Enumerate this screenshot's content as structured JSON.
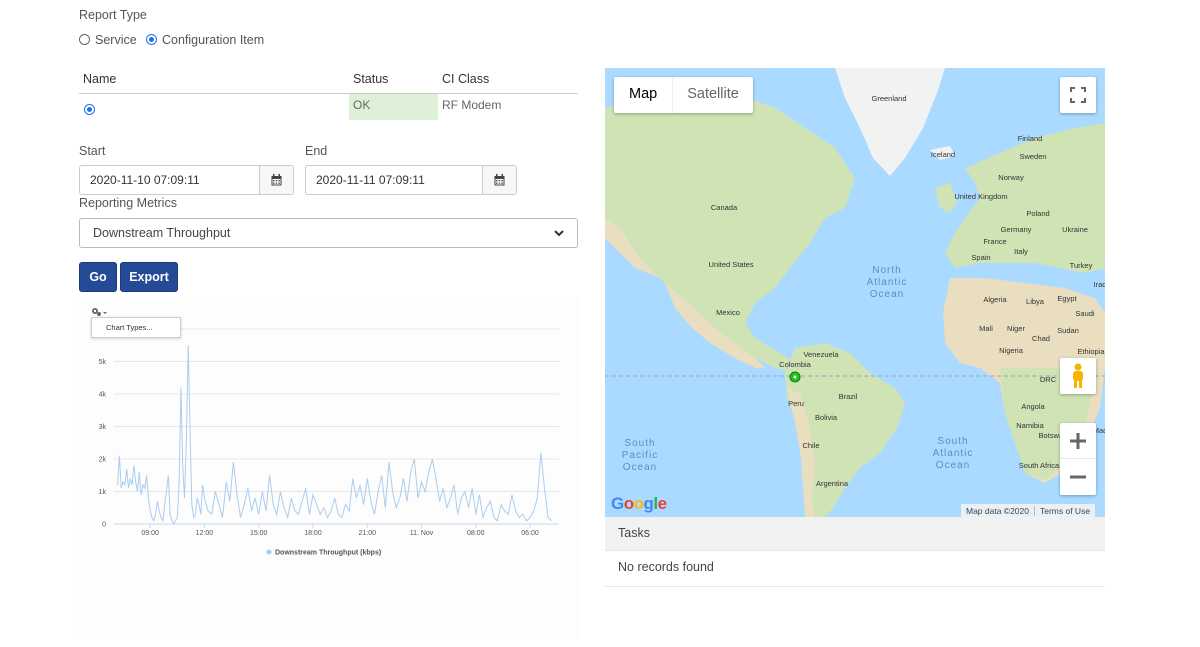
{
  "report_type": {
    "label": "Report Type",
    "options": [
      {
        "label": "Service",
        "selected": false
      },
      {
        "label": "Configuration Item",
        "selected": true
      }
    ]
  },
  "ci_table": {
    "columns": [
      "Name",
      "Status",
      "CI Class"
    ],
    "rows": [
      {
        "name": "",
        "status": "OK",
        "ci_class": "RF Modem",
        "selected": true
      }
    ]
  },
  "dates": {
    "start_label": "Start",
    "start_value": "2020-11-10 07:09:11",
    "end_label": "End",
    "end_value": "2020-11-11 07:09:11"
  },
  "metrics": {
    "label": "Reporting Metrics",
    "selected": "Downstream Throughput"
  },
  "buttons": {
    "go": "Go",
    "export": "Export"
  },
  "chart_menu": {
    "item": "Chart Types..."
  },
  "chart_data": {
    "type": "line",
    "title": "",
    "series": [
      {
        "name": "Downstream Throughput (kbps)",
        "color": "#a9cdf0",
        "x": [
          7.2,
          7.3,
          7.4,
          7.5,
          7.6,
          7.7,
          7.8,
          7.9,
          8.0,
          8.1,
          8.2,
          8.3,
          8.4,
          8.5,
          8.6,
          8.7,
          8.8,
          8.9,
          9.0,
          9.1,
          9.2,
          9.3,
          9.4,
          9.5,
          9.6,
          9.7,
          9.8,
          9.9,
          10.0,
          10.1,
          10.2,
          10.3,
          10.4,
          10.5,
          10.6,
          10.7,
          10.8,
          10.9,
          11.0,
          11.1,
          11.2,
          11.3,
          11.4,
          11.5,
          11.6,
          11.7,
          11.8,
          11.9,
          12.0,
          12.2,
          12.4,
          12.6,
          12.8,
          13.0,
          13.2,
          13.4,
          13.6,
          13.8,
          14.0,
          14.2,
          14.4,
          14.6,
          14.8,
          15.0,
          15.2,
          15.4,
          15.6,
          15.8,
          16.0,
          16.2,
          16.4,
          16.6,
          16.8,
          17.0,
          17.2,
          17.4,
          17.6,
          17.8,
          18.0,
          18.2,
          18.4,
          18.6,
          18.8,
          19.0,
          19.2,
          19.4,
          19.6,
          19.8,
          20.0,
          20.2,
          20.4,
          20.6,
          20.8,
          21.0,
          21.2,
          21.4,
          21.6,
          21.8,
          22.0,
          22.2,
          22.4,
          22.6,
          22.8,
          23.0,
          23.2,
          23.4,
          23.6,
          23.8,
          24.0,
          24.2,
          24.4,
          24.6,
          24.8,
          25.0,
          25.2,
          25.4,
          25.6,
          25.8,
          26.0,
          26.2,
          26.4,
          26.6,
          26.8,
          27.0,
          27.2,
          27.4,
          27.6,
          27.8,
          28.0,
          28.2,
          28.4,
          28.6,
          28.8,
          29.0,
          29.2,
          29.4,
          29.6,
          29.8,
          30.0,
          30.2,
          30.4,
          30.6,
          30.8,
          31.0,
          31.2
        ],
        "values": [
          1200,
          2100,
          1100,
          1300,
          1200,
          1700,
          1100,
          1400,
          1200,
          1800,
          1300,
          1000,
          1600,
          900,
          1200,
          1100,
          1500,
          800,
          400,
          200,
          100,
          300,
          700,
          400,
          200,
          100,
          600,
          1000,
          1500,
          300,
          100,
          0,
          100,
          200,
          1200,
          4200,
          1800,
          800,
          2600,
          5500,
          3000,
          600,
          200,
          300,
          800,
          600,
          300,
          1200,
          800,
          400,
          300,
          1000,
          600,
          200,
          1300,
          700,
          1900,
          900,
          200,
          600,
          1100,
          400,
          800,
          300,
          1000,
          400,
          1500,
          600,
          300,
          1000,
          500,
          200,
          800,
          400,
          300,
          700,
          1100,
          300,
          900,
          600,
          300,
          500,
          200,
          400,
          800,
          300,
          200,
          600,
          400,
          1400,
          800,
          1200,
          600,
          1400,
          700,
          300,
          1000,
          1500,
          500,
          1900,
          1000,
          500,
          800,
          1400,
          700,
          1600,
          2000,
          800,
          1300,
          1000,
          1600,
          2000,
          1400,
          700,
          1100,
          500,
          800,
          1200,
          300,
          800,
          1000,
          500,
          1100,
          300,
          900,
          200,
          500,
          700,
          200,
          100,
          600,
          400,
          300,
          900,
          400,
          200,
          300,
          100,
          200,
          400,
          800,
          2200,
          1100,
          200,
          100
        ]
      }
    ],
    "xlabel": "",
    "ylabel": "",
    "x_ticks": [
      {
        "x": 9,
        "label": "09:00"
      },
      {
        "x": 12,
        "label": "12:00"
      },
      {
        "x": 15,
        "label": "15:00"
      },
      {
        "x": 18,
        "label": "18:00"
      },
      {
        "x": 21,
        "label": "21:00"
      },
      {
        "x": 24,
        "label": "11. Nov"
      },
      {
        "x": 27,
        "label": "08:00"
      },
      {
        "x": 30,
        "label": "06:00"
      }
    ],
    "y_ticks": [
      {
        "y": 0,
        "label": "0"
      },
      {
        "y": 1000,
        "label": "1k"
      },
      {
        "y": 2000,
        "label": "2k"
      },
      {
        "y": 3000,
        "label": "3k"
      },
      {
        "y": 4000,
        "label": "4k"
      },
      {
        "y": 5000,
        "label": "5k"
      }
    ],
    "xlim": [
      7.0,
      31.6
    ],
    "ylim": [
      0,
      6000
    ],
    "grid": true,
    "legend": "bottom"
  },
  "map": {
    "tabs": [
      "Map",
      "Satellite"
    ],
    "active_tab": "Map",
    "oceans": [
      "North Atlantic Ocean",
      "South Pacific Ocean",
      "South Atlantic Ocean"
    ],
    "places": [
      "Greenland",
      "Iceland",
      "Finland",
      "Sweden",
      "Norway",
      "United Kingdom",
      "Canada",
      "Poland",
      "Germany",
      "Ukraine",
      "France",
      "Italy",
      "Spain",
      "Turkey",
      "United States",
      "Algeria",
      "Libya",
      "Egypt",
      "Mexico",
      "Mali",
      "Niger",
      "Sudan",
      "Chad",
      "Nigeria",
      "Ethiopia",
      "Venezuela",
      "Colombia",
      "DRC",
      "Peru",
      "Brazil",
      "Angola",
      "Bolivia",
      "Namibia",
      "Botswana",
      "Chile",
      "South Africa",
      "Argentina",
      "Saudi",
      "Iraq",
      "Mad"
    ],
    "attribution": "Map data ©2020",
    "terms": "Terms of Use",
    "logo": "Google",
    "marker_color": "#22c022"
  },
  "tasks": {
    "title": "Tasks",
    "empty": "No records found"
  }
}
